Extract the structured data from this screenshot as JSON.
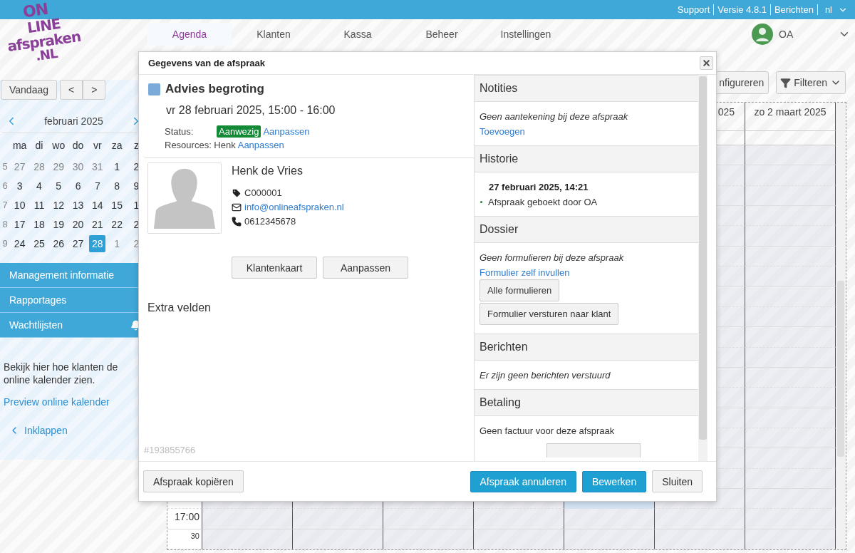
{
  "logo": {
    "lines": [
      "ON",
      "LINE",
      "afspraken",
      ".NL"
    ]
  },
  "top_links": [
    "Support",
    "Versie 4.8.1",
    "Berichten"
  ],
  "language": {
    "label": "nl"
  },
  "nav": {
    "tabs": [
      {
        "label": "Agenda",
        "selected": true
      },
      {
        "label": "Klanten",
        "selected": false
      },
      {
        "label": "Kassa",
        "selected": false
      },
      {
        "label": "Beheer",
        "selected": false
      },
      {
        "label": "Instellingen",
        "selected": false
      }
    ],
    "user": {
      "initials": "OA"
    }
  },
  "sidebar": {
    "today": "Vandaag",
    "prev": "<",
    "next": ">",
    "calendar": {
      "month": "februari 2025",
      "weekdays": [
        "ma",
        "di",
        "wo",
        "do",
        "vr",
        "za",
        "z"
      ],
      "weeks": [
        {
          "nr": "5",
          "days": [
            {
              "d": "27",
              "muted": true,
              "selected": false
            },
            {
              "d": "28",
              "muted": true,
              "selected": false
            },
            {
              "d": "29",
              "muted": true,
              "selected": false
            },
            {
              "d": "30",
              "muted": true,
              "selected": false
            },
            {
              "d": "31",
              "muted": true,
              "selected": false
            },
            {
              "d": "1",
              "muted": false,
              "selected": false
            },
            {
              "d": "2",
              "muted": false,
              "selected": false
            }
          ]
        },
        {
          "nr": "6",
          "days": [
            {
              "d": "3",
              "muted": false,
              "selected": false
            },
            {
              "d": "4",
              "muted": false,
              "selected": false
            },
            {
              "d": "5",
              "muted": false,
              "selected": false
            },
            {
              "d": "6",
              "muted": false,
              "selected": false
            },
            {
              "d": "7",
              "muted": false,
              "selected": false
            },
            {
              "d": "8",
              "muted": false,
              "selected": false
            },
            {
              "d": "9",
              "muted": false,
              "selected": false
            }
          ]
        },
        {
          "nr": "7",
          "days": [
            {
              "d": "10",
              "muted": false,
              "selected": false
            },
            {
              "d": "11",
              "muted": false,
              "selected": false
            },
            {
              "d": "12",
              "muted": false,
              "selected": false
            },
            {
              "d": "13",
              "muted": false,
              "selected": false
            },
            {
              "d": "14",
              "muted": false,
              "selected": false
            },
            {
              "d": "15",
              "muted": false,
              "selected": false
            },
            {
              "d": "1",
              "muted": false,
              "selected": false
            }
          ]
        },
        {
          "nr": "8",
          "days": [
            {
              "d": "17",
              "muted": false,
              "selected": false
            },
            {
              "d": "18",
              "muted": false,
              "selected": false
            },
            {
              "d": "19",
              "muted": false,
              "selected": false
            },
            {
              "d": "20",
              "muted": false,
              "selected": false
            },
            {
              "d": "21",
              "muted": false,
              "selected": false
            },
            {
              "d": "22",
              "muted": false,
              "selected": false
            },
            {
              "d": "2",
              "muted": false,
              "selected": false
            }
          ]
        },
        {
          "nr": "9",
          "days": [
            {
              "d": "24",
              "muted": false,
              "selected": false
            },
            {
              "d": "25",
              "muted": false,
              "selected": false
            },
            {
              "d": "26",
              "muted": false,
              "selected": false
            },
            {
              "d": "27",
              "muted": false,
              "selected": false
            },
            {
              "d": "28",
              "muted": false,
              "selected": true
            },
            {
              "d": "1",
              "muted": true,
              "selected": false
            },
            {
              "d": "2",
              "muted": true,
              "selected": false
            }
          ]
        }
      ]
    },
    "menu": [
      {
        "label": "Management informatie",
        "bell": false
      },
      {
        "label": "Rapportages",
        "bell": false
      },
      {
        "label": "Wachtlijsten",
        "bell": true
      }
    ],
    "info": "Bekijk hier hoe klanten de online kalender zien.",
    "preview_link": "Preview online kalender",
    "collapse": "Inklappen"
  },
  "toolbar": {
    "configure": "nfigureren",
    "filter": "Filteren"
  },
  "grid": {
    "day_headers": [
      "025",
      "zo 2 maart 2025"
    ],
    "times": [
      "17:00",
      "30"
    ]
  },
  "dialog": {
    "title": "Gegevens van de afspraak",
    "appointment": {
      "title": "Advies begroting",
      "color": "#7aaad8",
      "when": "vr 28 februari 2025, 15:00 - 16:00",
      "status_label": "Status:",
      "status": "Aanwezig",
      "status_edit": "Aanpassen",
      "resources_label": "Resources: Henk",
      "resources_edit": "Aanpassen"
    },
    "customer": {
      "name": "Henk de Vries",
      "number": "C000001",
      "email": "info@onlineafspraken.nl",
      "phone": "0612345678",
      "buttons": [
        "Klantenkaart",
        "Aanpassen"
      ]
    },
    "extra_title": "Extra velden",
    "id": "#193855766",
    "sections": [
      {
        "title": "Notities",
        "lines": [
          {
            "kind": "note",
            "text": "Geen aantekening bij deze afspraak"
          },
          {
            "kind": "link",
            "text": "Toevoegen"
          }
        ]
      },
      {
        "title": "Historie",
        "lines": [
          {
            "kind": "heading",
            "text": "27 februari 2025, 14:21"
          },
          {
            "kind": "bullet",
            "text": "Afspraak geboekt door OA"
          }
        ]
      },
      {
        "title": "Dossier",
        "lines": [
          {
            "kind": "note",
            "text": "Geen formulieren bij deze afspraak"
          },
          {
            "kind": "link",
            "text": "Formulier zelf invullen"
          },
          {
            "kind": "button",
            "text": "Alle formulieren"
          },
          {
            "kind": "button",
            "text": "Formulier versturen naar klant"
          }
        ]
      },
      {
        "title": "Berichten",
        "lines": [
          {
            "kind": "note",
            "text": "Er zijn geen berichten verstuurd"
          }
        ]
      },
      {
        "title": "Betaling",
        "lines": [
          {
            "kind": "text",
            "text": "Geen factuur voor deze afspraak"
          },
          {
            "kind": "cut_button"
          }
        ]
      }
    ],
    "footer": {
      "copy": "Afspraak kopiëren",
      "cancel": "Afspraak annuleren",
      "edit": "Bewerken",
      "close": "Sluiten"
    }
  }
}
